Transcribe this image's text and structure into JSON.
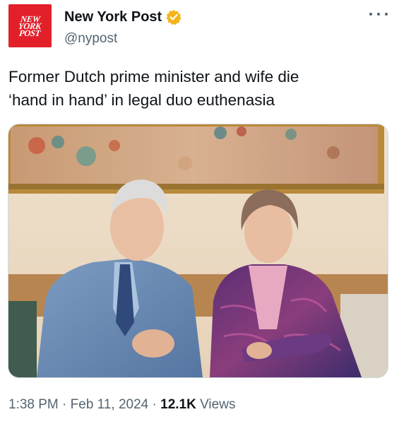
{
  "account": {
    "logo_lines": [
      "NEW",
      "YORK",
      "POST"
    ],
    "name": "New York Post",
    "handle": "@nypost",
    "verified_badge": "gold-check-badge-icon",
    "badge_color": "#f4b51c"
  },
  "menu": {
    "icon": "more-options-icon"
  },
  "tweet": {
    "lines": [
      "Former Dutch prime minister and wife die",
      "‘hand in hand’ in legal duo euthenasia"
    ]
  },
  "media": {
    "description_icon": "photo-image"
  },
  "meta": {
    "time": "1:38 PM",
    "separator": " · ",
    "date": "Feb 11, 2024",
    "views_count": "12.1K",
    "views_label": " Views"
  },
  "colors": {
    "brand_red": "#e3202a",
    "text": "#0f1419",
    "secondary": "#536471"
  }
}
